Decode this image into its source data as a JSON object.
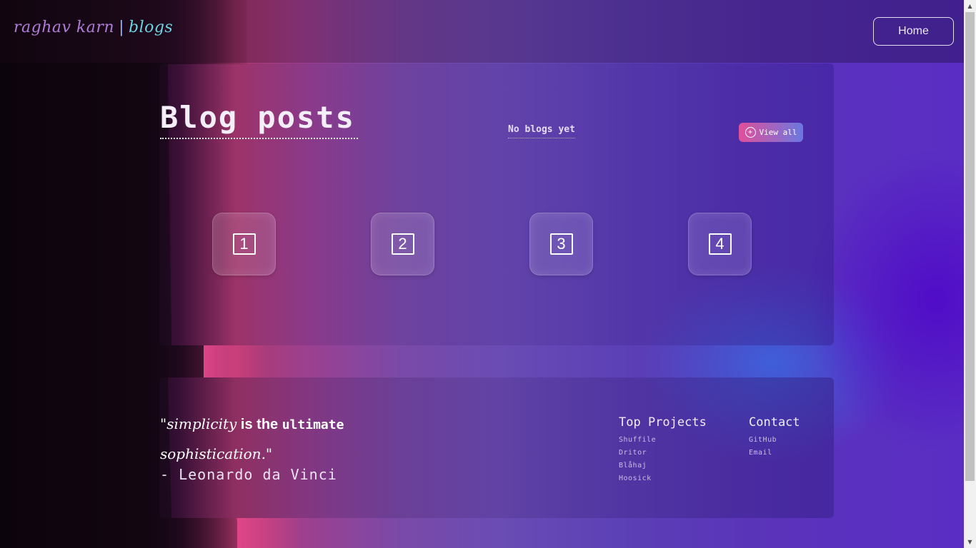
{
  "header": {
    "logo_name": "raghav karn",
    "logo_separator": "|",
    "logo_section": "blogs",
    "home_label": "Home"
  },
  "blog": {
    "title": "Blog posts",
    "empty_message": "No blogs yet",
    "view_all_label": "View all",
    "view_all_icon": "plus-circle-icon",
    "pages": [
      "1",
      "2",
      "3",
      "4"
    ]
  },
  "footer": {
    "quote": {
      "open": "\"simplicity",
      "mid": " is the ",
      "strong": "ultimate",
      "end": "sophistication.\""
    },
    "author": "- Leonardo da Vinci",
    "projects": {
      "title": "Top Projects",
      "items": [
        "Shuffile",
        "Dritor",
        "Blåhaj",
        "Hoosick"
      ]
    },
    "contact": {
      "title": "Contact",
      "items": [
        "GitHub",
        "Email"
      ]
    }
  },
  "colors": {
    "accent_pink": "#e0509a",
    "accent_blue": "#6a78e0",
    "logo_purple": "#b07cd8",
    "logo_cyan": "#6fd2e4"
  }
}
